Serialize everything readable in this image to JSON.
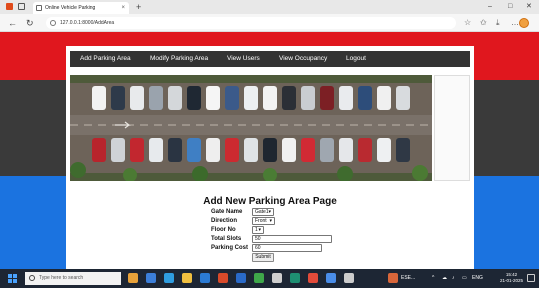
{
  "browser": {
    "tab_title": "Online Vehicle Parking",
    "tab_close": "×",
    "new_tab": "+",
    "url": "127.0.0.1:8000/AddArea",
    "win_min": "–",
    "win_max": "□",
    "win_close": "✕"
  },
  "nav": {
    "items": [
      "Add Parking Area",
      "Modify Parking Area",
      "View Users",
      "View Occupancy",
      "Logout"
    ]
  },
  "form": {
    "title": "Add New Parking Area Page",
    "fields": [
      {
        "label": "Gate Name",
        "value": "Gate1"
      },
      {
        "label": "Direction",
        "value": "Front"
      },
      {
        "label": "Floor No",
        "value": "1"
      },
      {
        "label": "Total Slots",
        "value": "50"
      },
      {
        "label": "Parking Cost",
        "value": "60"
      }
    ],
    "submit_label": "Submit"
  },
  "taskbar": {
    "search_placeholder": "Type here to search",
    "tray_label": "ESE...",
    "lang": "ENG",
    "time": "15:42",
    "date": "21-01-2025"
  },
  "colors": {
    "band_red": "#e0171e",
    "band_dark": "#3a3a3a",
    "band_blue": "#1b73e0",
    "navbar": "#333333",
    "taskbar": "#1d2634"
  }
}
